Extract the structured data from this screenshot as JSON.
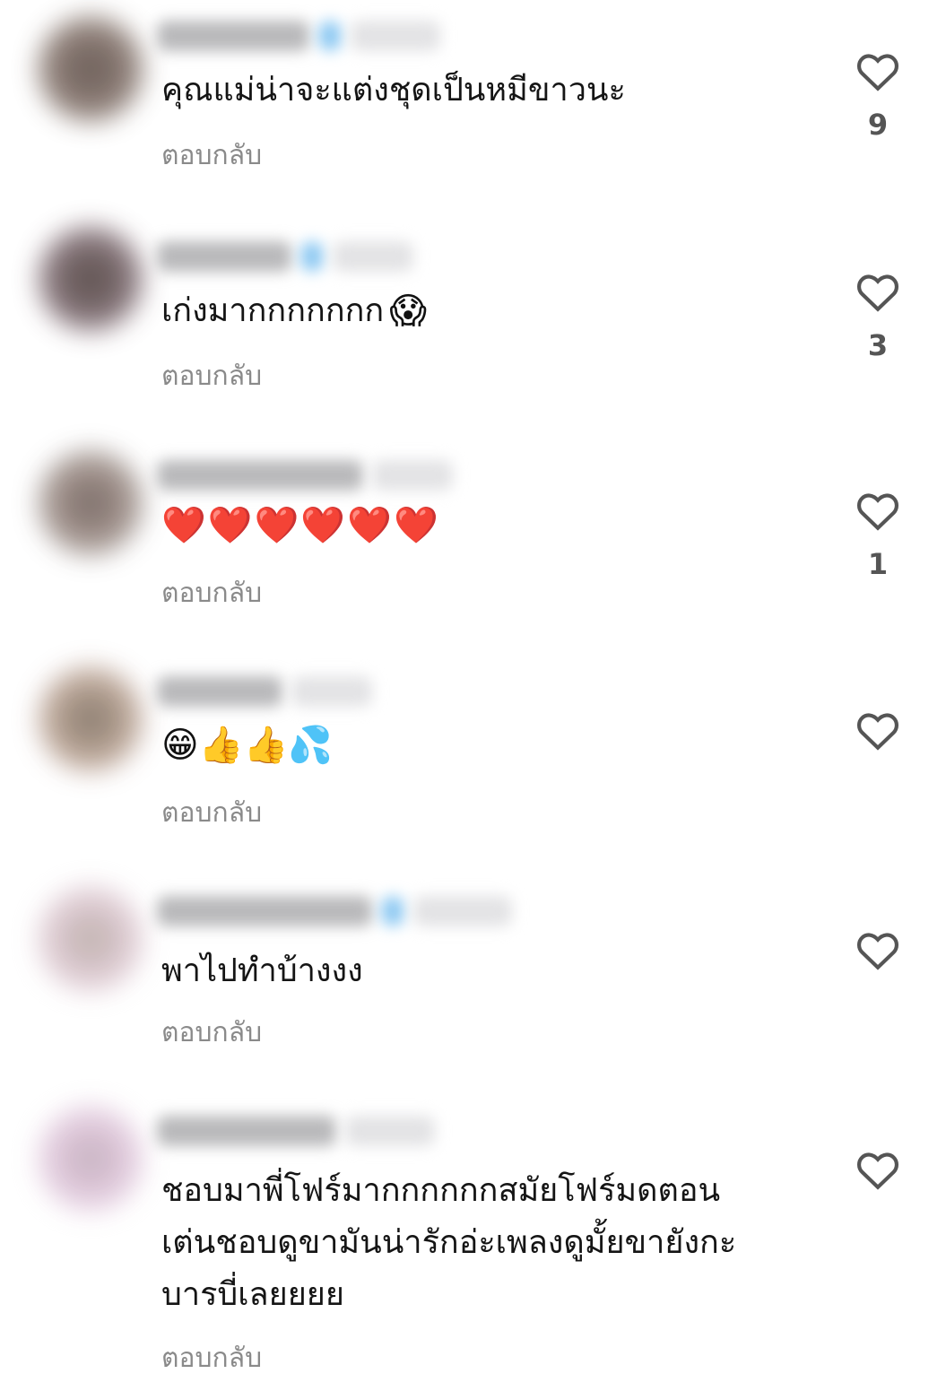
{
  "reply_label": "ตอบกลับ",
  "colors": {
    "text": "#151515",
    "reply": "#8a8a8a",
    "heart_outline": "#555555",
    "emoji_heart": "#f0285a"
  },
  "comments": [
    {
      "text": "คุณแม่น่าจะแต่งชุดเป็นหมีขาวนะ",
      "likes": "9"
    },
    {
      "text": "เก่งมากกกกกกก",
      "emoji": "😱",
      "likes": "3"
    },
    {
      "emoji": "❤️❤️❤️❤️❤️❤️",
      "likes": "1"
    },
    {
      "emoji": "😁👍👍💦",
      "likes": ""
    },
    {
      "text": "พาไปทำบ้างงง",
      "likes": ""
    },
    {
      "text": "ชอบมาพี่โฟร์มากกกกกกสมัยโฟร์มดตอน\nเต่นชอบดูขามันน่ารักอ่ะเพลงดูมั้ยขายังกะ\nบารบี่เลยยยย",
      "likes": ""
    }
  ]
}
